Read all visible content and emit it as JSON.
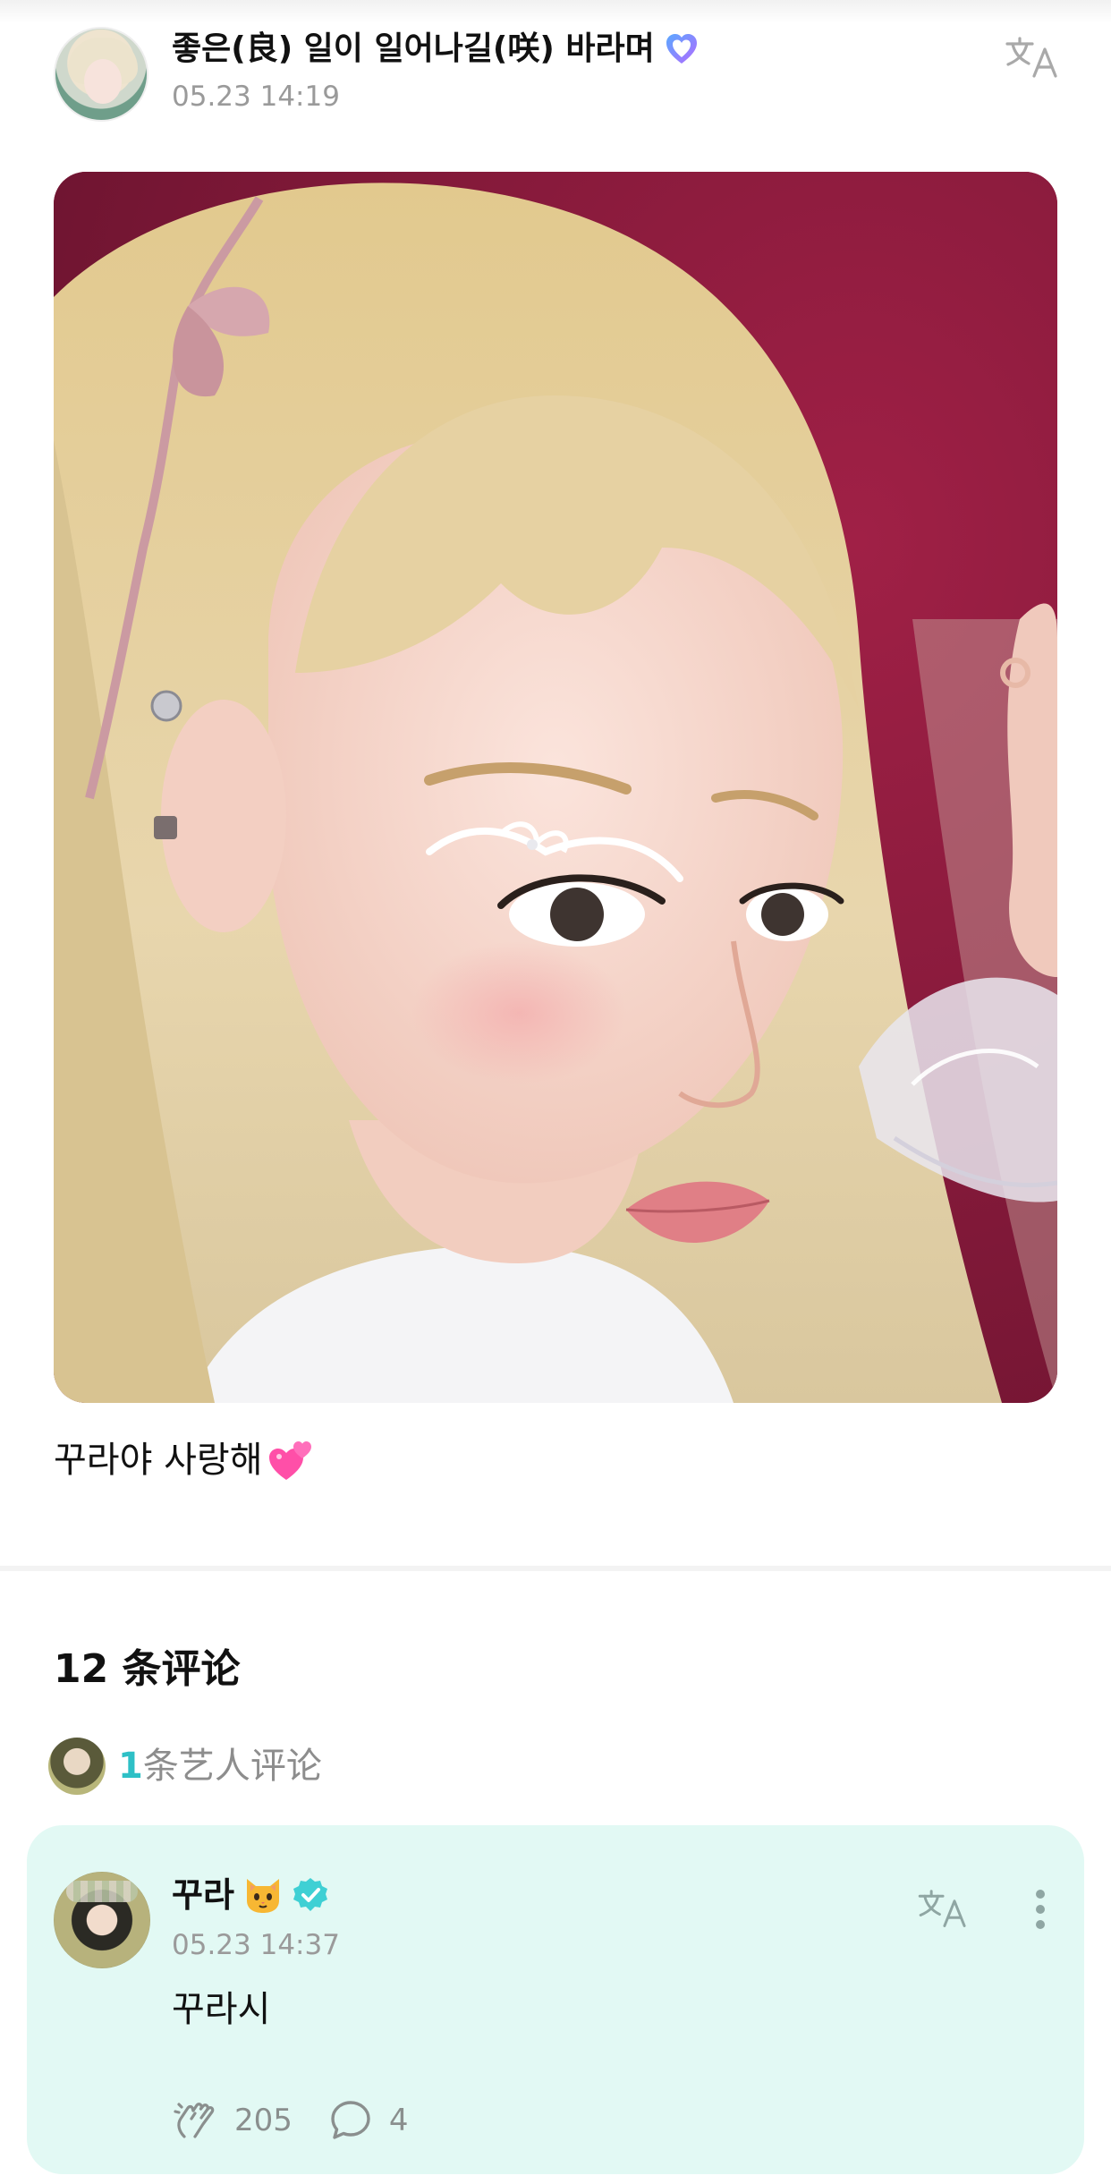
{
  "post": {
    "author_name": "좋은(良) 일이 일어나길(咲) 바라며",
    "author_badge_icon": "purple-heart-badge-icon",
    "timestamp": "05.23 14:19",
    "translate_icon": "translate-icon",
    "image_icon": "photo-blonde-girl-with-ribbon",
    "caption": "꾸라야 사랑해",
    "caption_emoji": "two-hearts-emoji"
  },
  "comments": {
    "title": "12 条评论",
    "artist_row": {
      "count": "1",
      "label": "条艺人评论"
    },
    "artist_comment": {
      "name": "꾸라",
      "name_emoji": "cat-face-emoji",
      "verified_icon": "verified-check-icon",
      "timestamp": "05.23 14:37",
      "text": "꾸라시",
      "likes": "205",
      "replies": "4"
    }
  },
  "colors": {
    "accent": "#2ec0c6",
    "card_background": "#e2f9f4",
    "verified": "#3fd0d4",
    "muted_text": "#9a9a9a",
    "image_background": "#8e1a3c"
  }
}
